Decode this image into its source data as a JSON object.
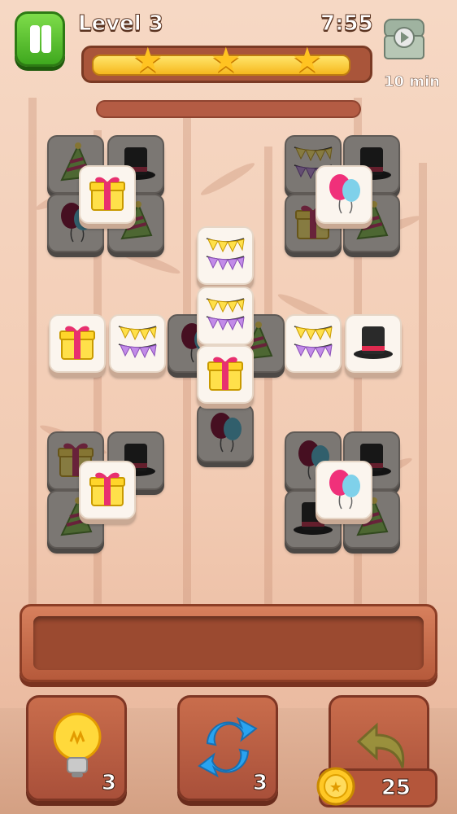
{
  "header": {
    "level_title": "Level 3",
    "timer": "7:55",
    "time_bonus": "10 min",
    "progress": 0.95,
    "stars_earned": 3
  },
  "board": {
    "tiles": [
      {
        "icon": "party-hat-icon",
        "state": "blocked"
      },
      {
        "icon": "top-hat-icon",
        "state": "blocked"
      },
      {
        "icon": "balloon-icon",
        "state": "blocked"
      },
      {
        "icon": "party-hat-icon",
        "state": "blocked"
      },
      {
        "icon": "gift-box-icon",
        "state": "active"
      },
      {
        "icon": "bunting-flags-icon",
        "state": "blocked"
      },
      {
        "icon": "top-hat-icon",
        "state": "blocked"
      },
      {
        "icon": "gift-box-icon",
        "state": "blocked"
      },
      {
        "icon": "party-hat-icon",
        "state": "blocked"
      },
      {
        "icon": "balloons-icon",
        "state": "active"
      },
      {
        "icon": "bunting-flags-icon",
        "state": "active"
      },
      {
        "icon": "bunting-flags-icon",
        "state": "active"
      },
      {
        "icon": "gift-box-icon",
        "state": "active"
      },
      {
        "icon": "balloon-icon",
        "state": "blocked"
      },
      {
        "icon": "party-hat-icon",
        "state": "blocked"
      },
      {
        "icon": "bunting-flags-icon",
        "state": "active"
      },
      {
        "icon": "top-hat-icon",
        "state": "active"
      },
      {
        "icon": "bunting-flags-icon",
        "state": "active"
      },
      {
        "icon": "gift-box-icon",
        "state": "active"
      },
      {
        "icon": "balloon-icon",
        "state": "blocked"
      },
      {
        "icon": "gift-box-icon",
        "state": "blocked"
      },
      {
        "icon": "party-hat-icon",
        "state": "blocked"
      },
      {
        "icon": "top-hat-icon",
        "state": "blocked"
      },
      {
        "icon": "gift-box-icon",
        "state": "active"
      },
      {
        "icon": "balloon-icon",
        "state": "blocked"
      },
      {
        "icon": "top-hat-icon",
        "state": "blocked"
      },
      {
        "icon": "top-hat-icon",
        "state": "blocked"
      },
      {
        "icon": "party-hat-icon",
        "state": "blocked"
      },
      {
        "icon": "balloons-icon",
        "state": "active"
      }
    ]
  },
  "boosters": {
    "hint": {
      "count": "3",
      "icon": "lightbulb-icon"
    },
    "shuffle": {
      "count": "3",
      "icon": "shuffle-arrows-icon"
    },
    "undo": {
      "icon": "undo-arrow-icon"
    }
  },
  "coins": {
    "count": "25",
    "icon": "gold-coin-icon"
  },
  "colors": {
    "accent_green": "#4cb526",
    "tray_wood": "#b65a3b",
    "star_gold": "#ffc321"
  }
}
